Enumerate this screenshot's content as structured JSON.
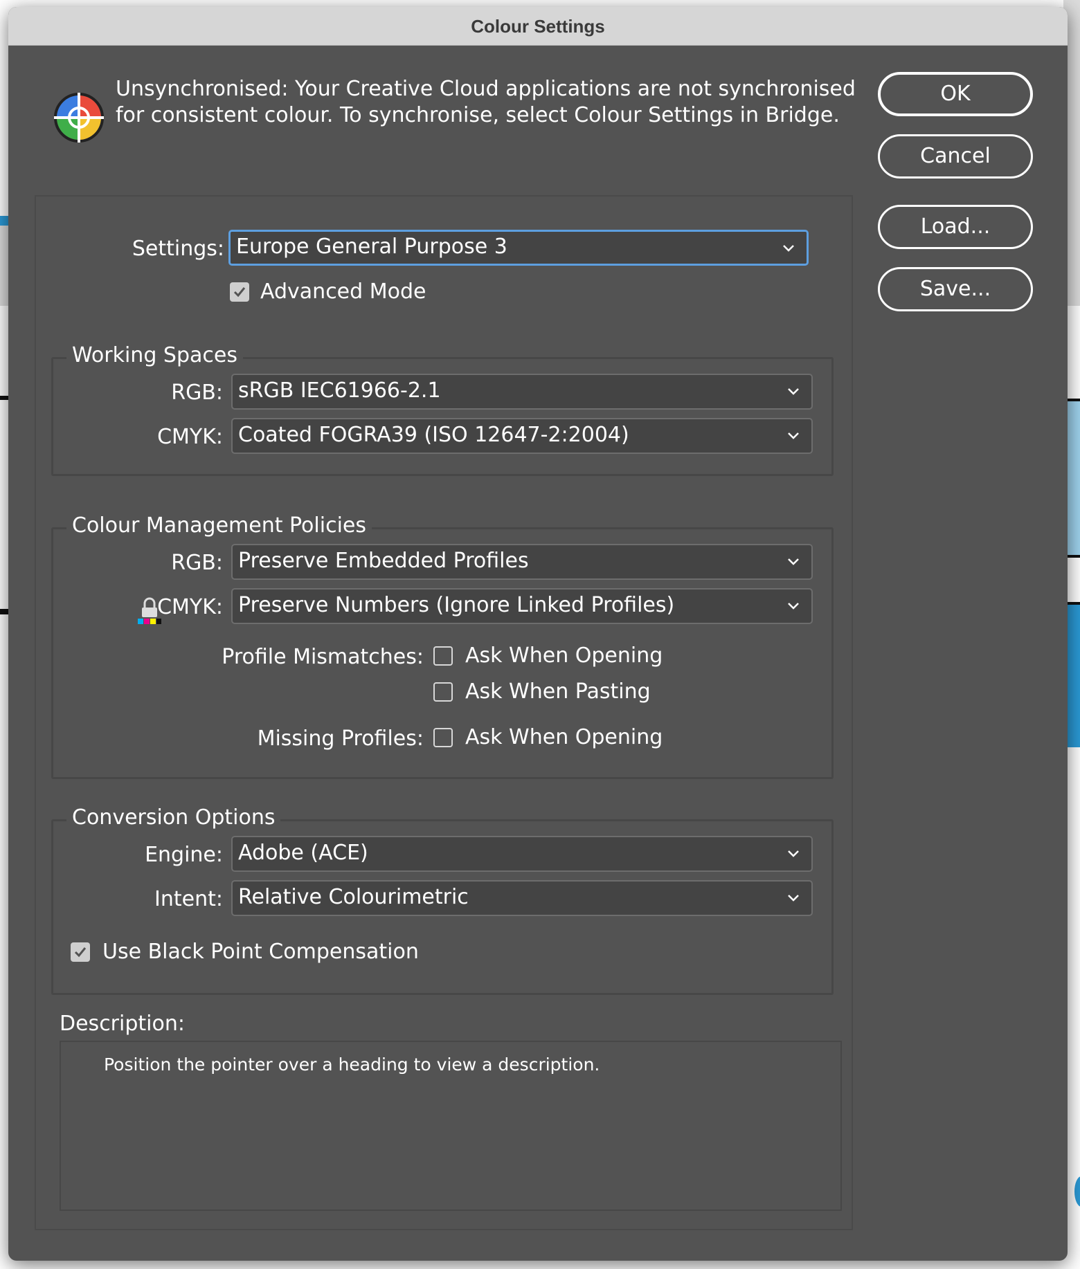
{
  "window": {
    "title": "Colour Settings"
  },
  "header": {
    "icon": "colour-sync-icon",
    "message": "Unsynchronised: Your Creative Cloud applications are not synchronised for consistent colour. To synchronise, select Colour Settings in Bridge."
  },
  "buttons": {
    "ok": "OK",
    "cancel": "Cancel",
    "load": "Load...",
    "save": "Save..."
  },
  "settings": {
    "label": "Settings:",
    "value": "Europe General Purpose 3",
    "advanced_mode_label": "Advanced Mode",
    "advanced_mode_checked": true
  },
  "working_spaces": {
    "title": "Working Spaces",
    "rgb_label": "RGB:",
    "rgb_value": "sRGB IEC61966-2.1",
    "cmyk_label": "CMYK:",
    "cmyk_value": "Coated FOGRA39 (ISO 12647-2:2004)"
  },
  "policies": {
    "title": "Colour Management Policies",
    "rgb_label": "RGB:",
    "rgb_value": "Preserve Embedded Profiles",
    "cmyk_label": "CMYK:",
    "cmyk_value": "Preserve Numbers (Ignore Linked Profiles)",
    "profile_mismatches_label": "Profile Mismatches:",
    "ask_when_opening_label": "Ask When Opening",
    "ask_when_opening_checked": false,
    "ask_when_pasting_label": "Ask When Pasting",
    "ask_when_pasting_checked": false,
    "missing_profiles_label": "Missing Profiles:",
    "missing_ask_when_opening_label": "Ask When Opening",
    "missing_ask_when_opening_checked": false
  },
  "conversion": {
    "title": "Conversion Options",
    "engine_label": "Engine:",
    "engine_value": "Adobe (ACE)",
    "intent_label": "Intent:",
    "intent_value": "Relative Colourimetric",
    "black_point_label": "Use Black Point Compensation",
    "black_point_checked": true
  },
  "description": {
    "label": "Description:",
    "text": "Position the pointer over a heading to view a description."
  }
}
